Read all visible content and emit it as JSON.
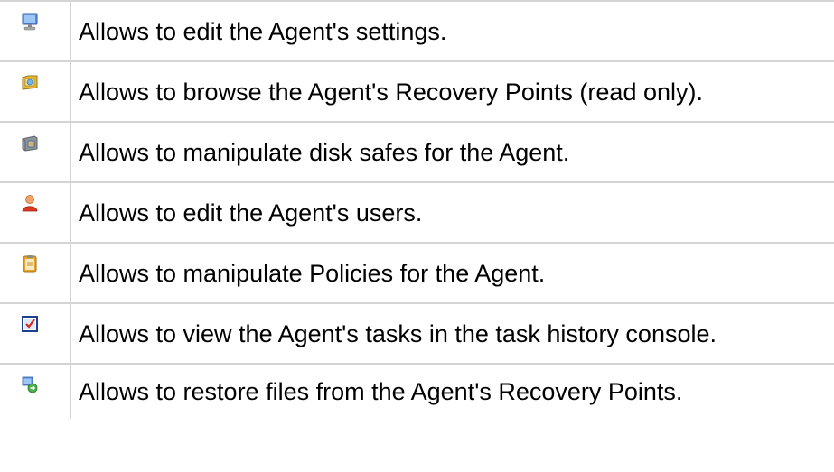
{
  "permissions": [
    {
      "icon": "computer-icon",
      "text": "Allows to edit the Agent's settings."
    },
    {
      "icon": "recovery-points-icon",
      "text": "Allows to browse the Agent's Recovery Points (read only)."
    },
    {
      "icon": "disk-safe-icon",
      "text": "Allows to manipulate disk safes for the Agent."
    },
    {
      "icon": "user-icon",
      "text": "Allows to edit the Agent's users."
    },
    {
      "icon": "policy-clipboard-icon",
      "text": "Allows to manipulate Policies for the Agent."
    },
    {
      "icon": "task-history-icon",
      "text": "Allows to view the Agent's tasks in the task history console."
    },
    {
      "icon": "restore-files-icon",
      "text": "Allows to restore files from the Agent's Recovery Points."
    }
  ],
  "colors": {
    "border": "#d4d4d4",
    "text": "#000000"
  }
}
